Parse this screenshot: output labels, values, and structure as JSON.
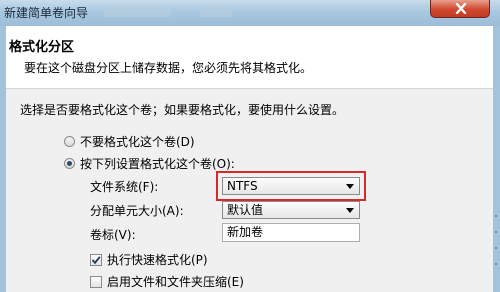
{
  "window": {
    "title": "新建简单卷向导",
    "close_icon": "close-icon"
  },
  "header": {
    "title": "格式化分区",
    "subtitle": "要在这个磁盘分区上储存数据，您必须先将其格式化。"
  },
  "content": {
    "prompt": "选择是否要格式化这个卷；如果要格式化，要使用什么设置。",
    "radio_no_format": {
      "label": "不要格式化这个卷(D)",
      "selected": false
    },
    "radio_format": {
      "label": "按下列设置格式化这个卷(O):",
      "selected": true
    },
    "file_system": {
      "label": "文件系统(F):",
      "value": "NTFS"
    },
    "allocation_unit": {
      "label": "分配单元大小(A):",
      "value": "默认值"
    },
    "volume_label": {
      "label": "卷标(V):",
      "value": "新加卷"
    },
    "quick_format": {
      "label": "执行快速格式化(P)",
      "checked": true
    },
    "compression": {
      "label": "启用文件和文件夹压缩(E)",
      "checked": false
    }
  },
  "colors": {
    "highlight_border": "#d42a2a",
    "close_button": "#d0492f",
    "title_bar": "#a9c7e0"
  }
}
